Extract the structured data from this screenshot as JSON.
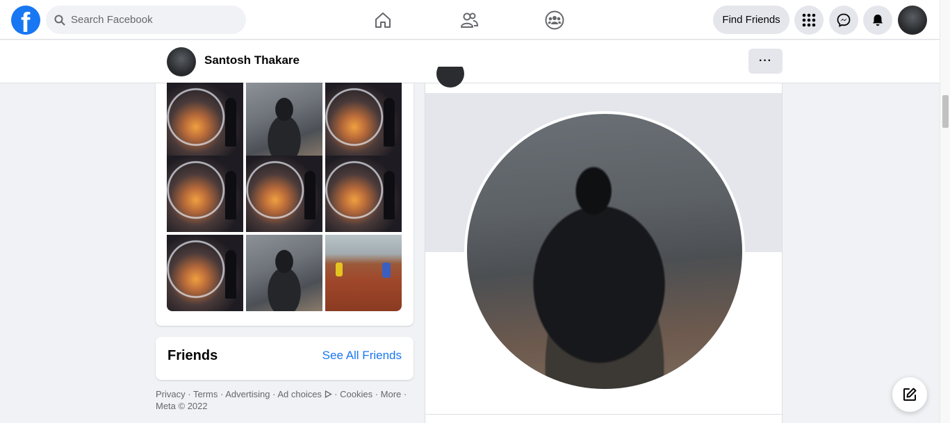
{
  "topbar": {
    "logo_icon": "facebook-logo-icon",
    "logo_glyph": "f",
    "search_placeholder": "Search Facebook",
    "nav": [
      "home-icon",
      "friends-icon",
      "groups-icon"
    ],
    "find_friends_label": "Find Friends",
    "actions": [
      "menu-grid-icon",
      "messenger-icon",
      "notifications-icon",
      "account-avatar"
    ]
  },
  "profile_bar": {
    "name": "Santosh Thakare",
    "more_label": "···"
  },
  "photos": {
    "items": [
      "globe",
      "camera",
      "globe",
      "globe",
      "globe",
      "globe",
      "globe",
      "camera",
      "playground"
    ]
  },
  "friends": {
    "title": "Friends",
    "see_all_label": "See All Friends"
  },
  "footer": {
    "links": [
      "Privacy",
      "Terms",
      "Advertising",
      "Ad choices",
      "Cookies",
      "More"
    ],
    "copyright": "Meta © 2022"
  },
  "colors": {
    "brand": "#1877f2",
    "background": "#f0f2f5",
    "button_gray": "#e4e6eb"
  }
}
